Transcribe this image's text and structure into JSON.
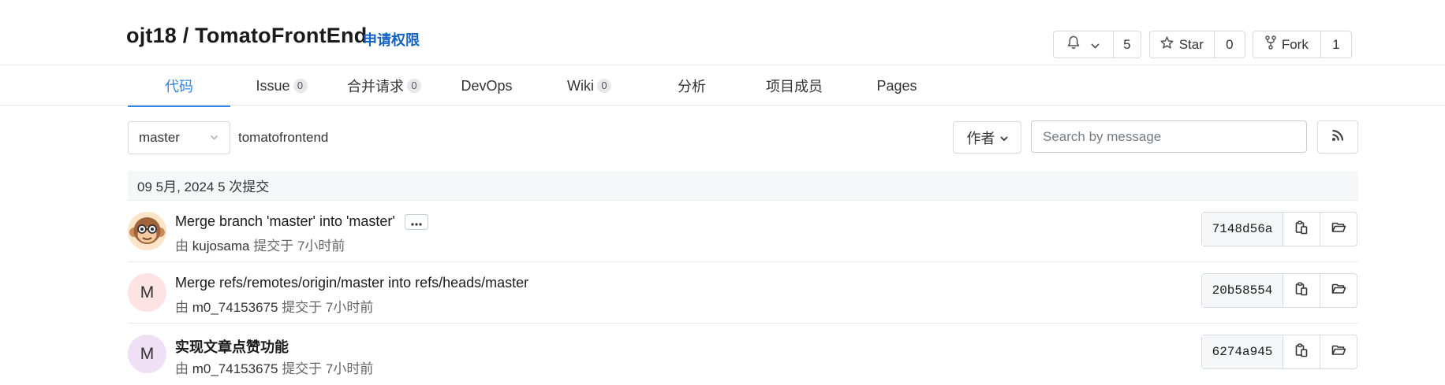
{
  "repo": {
    "owner": "ojt18",
    "separator": " / ",
    "name": "TomatoFrontEnd",
    "apply_permission": "申请权限"
  },
  "actions": {
    "watch_count": "5",
    "star_label": "Star",
    "star_count": "0",
    "fork_label": "Fork",
    "fork_count": "1"
  },
  "tabs": [
    {
      "label": "代码",
      "count": null,
      "active": true
    },
    {
      "label": "Issue",
      "count": "0"
    },
    {
      "label": "合并请求",
      "count": "0"
    },
    {
      "label": "DevOps",
      "count": null
    },
    {
      "label": "Wiki",
      "count": "0"
    },
    {
      "label": "分析",
      "count": null
    },
    {
      "label": "项目成员",
      "count": null
    },
    {
      "label": "Pages",
      "count": null
    }
  ],
  "toolbar": {
    "branch": "master",
    "path": "tomatofrontend",
    "author_filter": "作者",
    "search_placeholder": "Search by message"
  },
  "day_group": {
    "header": "09 5月, 2024 5 次提交"
  },
  "commits": [
    {
      "title": "Merge branch 'master' into 'master'",
      "by": "由",
      "author": "kujosama",
      "committed": "提交于 7小时前",
      "sha": "7148d56a",
      "avatar": "monkey"
    },
    {
      "title": "Merge refs/remotes/origin/master into refs/heads/master",
      "by": "由",
      "author": "m0_74153675",
      "committed": "提交于 7小时前",
      "sha": "20b58554",
      "avatar_letter": "M"
    },
    {
      "title": "实现文章点赞功能",
      "by": "由",
      "author": "m0_74153675",
      "committed": "提交于 7小时前",
      "sha": "6274a945",
      "avatar_letter": "M"
    }
  ],
  "colors": {
    "accent": "#2f86e8",
    "link": "#1362c4",
    "border": "#d6d9dd"
  },
  "icons": [
    "bell-icon",
    "chevron-down-icon",
    "star-icon",
    "fork-icon",
    "rss-icon",
    "more-icon",
    "copy-icon",
    "folder-icon"
  ]
}
